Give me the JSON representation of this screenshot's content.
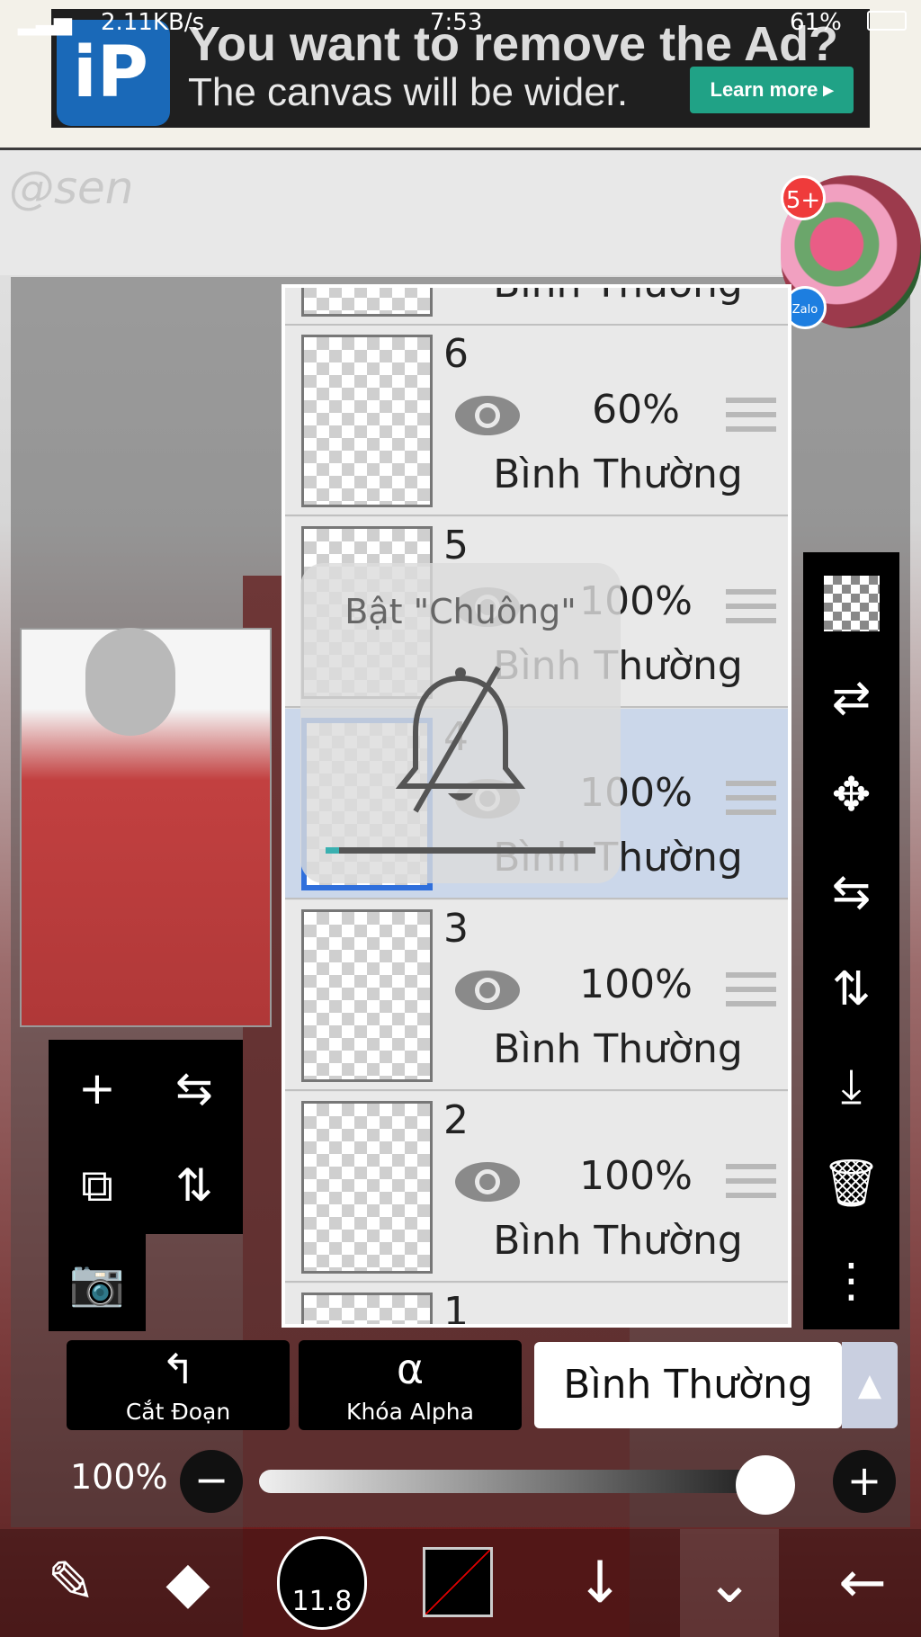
{
  "status_bar": {
    "speed": "2.11KB/s",
    "time": "7:53",
    "battery": "61%"
  },
  "ad": {
    "title": "You want to remove the Ad?",
    "subtitle": "The canvas will be wider.",
    "button": "Learn more ▸",
    "logo": "iP"
  },
  "canvas": {
    "signature": "@sen"
  },
  "chat_bubble": {
    "badge": "5+",
    "app": "Zalo"
  },
  "layers": [
    {
      "num": "6",
      "opacity": "60%",
      "blend": "Bình Thường",
      "selected": false
    },
    {
      "num": "5",
      "opacity": "100%",
      "blend": "Bình Thường",
      "selected": false
    },
    {
      "num": "4",
      "opacity": "100%",
      "blend": "Bình Thường",
      "selected": true
    },
    {
      "num": "3",
      "opacity": "100%",
      "blend": "Bình Thường",
      "selected": false
    },
    {
      "num": "2",
      "opacity": "100%",
      "blend": "Bình Thường",
      "selected": false
    },
    {
      "num": "1",
      "opacity": "",
      "blend": "",
      "selected": false
    }
  ],
  "top_partial_layer": {
    "blend": "Bình Thường"
  },
  "popup": {
    "title": "Bật \"Chuông\"",
    "progress": 0.05
  },
  "left_tools": {
    "add": "+",
    "add_copy": "⧉",
    "camera": "📷",
    "flip_h": "⇆",
    "flip_v": "⇅"
  },
  "buttons": {
    "clip": "Cắt Đoạn",
    "alpha_lock": "Khóa Alpha"
  },
  "blend_mode": "Bình Thường",
  "opacity": {
    "label": "100%",
    "value": 1.0
  },
  "bottom_toolbar": {
    "brush_size": "11.8"
  },
  "icons": [
    "eye-icon",
    "menu-icon",
    "bell-off-icon",
    "checker-icon",
    "transform-icon",
    "move-icon",
    "flip-h-icon",
    "flip-v-icon",
    "merge-down-icon",
    "trash-icon",
    "more-icon"
  ]
}
